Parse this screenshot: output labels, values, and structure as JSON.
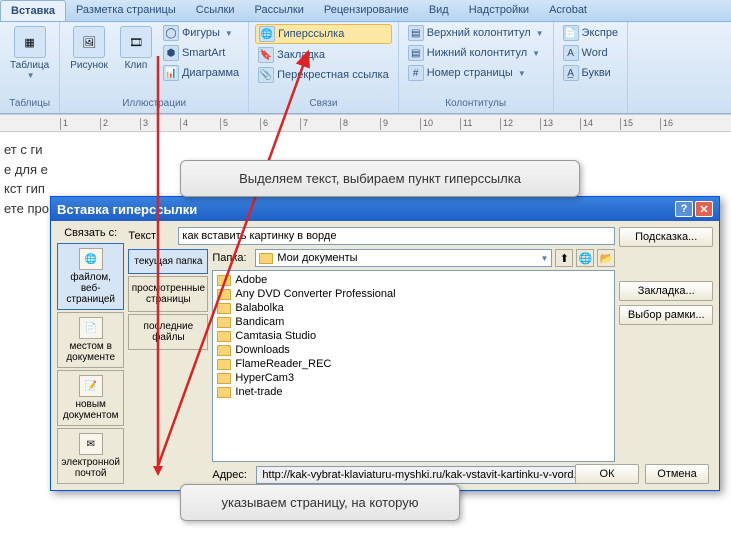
{
  "ribbon": {
    "tabs": [
      "Вставка",
      "Разметка страницы",
      "Ссылки",
      "Рассылки",
      "Рецензирование",
      "Вид",
      "Надстройки",
      "Acrobat"
    ],
    "active_tab": 0,
    "groups": {
      "tables": {
        "label": "Таблицы",
        "btn": "Таблица"
      },
      "illustrations": {
        "label": "Иллюстрации",
        "pic": "Рисунок",
        "clip": "Клип",
        "shapes": "Фигуры",
        "smartart": "SmartArt",
        "chart": "Диаграмма"
      },
      "links": {
        "label": "Связи",
        "hyperlink": "Гиперссылка",
        "bookmark": "Закладка",
        "crossref": "Перекрестная ссылка"
      },
      "headerfooter": {
        "label": "Колонтитулы",
        "header": "Верхний колонтитул",
        "footer": "Нижний колонтитул",
        "pagenum": "Номер страницы"
      },
      "text": {
        "label": "",
        "express": "Экспре",
        "wordart": "Word",
        "dropcap": "Букви"
      }
    }
  },
  "callouts": {
    "c1": "Выделяем текст, выбираем пункт гиперссылка",
    "c2": "указываем страницу, на которую"
  },
  "doc_text": [
    "ет с ги",
    "е для е",
    "кст гип",
    "ете про"
  ],
  "dialog": {
    "title": "Вставка гиперссылки",
    "link_to_label": "Связать с:",
    "link_to": [
      {
        "label": "файлом, веб-страницей",
        "active": true
      },
      {
        "label": "местом в документе"
      },
      {
        "label": "новым документом"
      },
      {
        "label": "электронной почтой"
      }
    ],
    "text_label": "Текст:",
    "text_value": "как вставить картинку в ворде",
    "tooltip_btn": "Подсказка...",
    "folder_label": "Папка:",
    "folder_value": "Мои документы",
    "lookin": [
      {
        "label": "текущая папка",
        "active": true
      },
      {
        "label": "просмотренные страницы"
      },
      {
        "label": "последние файлы"
      }
    ],
    "files": [
      "Adobe",
      "Any DVD Converter Professional",
      "Balabolka",
      "Bandicam",
      "Camtasia Studio",
      "Downloads",
      "FlameReader_REC",
      "HyperCam3",
      "Inet-trade"
    ],
    "addr_label": "Адрес:",
    "addr_value": "http://kak-vybrat-klaviaturu-myshki.ru/kak-vstavit-kartinku-v-vord.html",
    "bookmark_btn": "Закладка...",
    "frame_btn": "Выбор рамки...",
    "ok": "ОК",
    "cancel": "Отмена"
  }
}
